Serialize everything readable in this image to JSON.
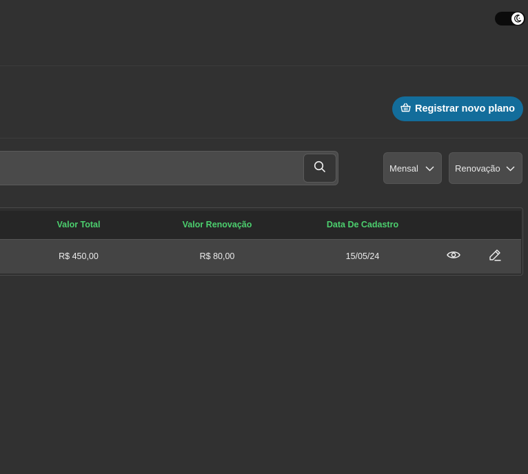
{
  "header": {
    "theme_toggle_icon": "moon-icon"
  },
  "actions": {
    "register_label": "Registrar novo plano",
    "register_icon": "basket-icon"
  },
  "filters": {
    "search_value": "",
    "search_icon": "search-icon",
    "period_select": {
      "selected": "Mensal"
    },
    "type_select": {
      "selected": "Renovação"
    }
  },
  "table": {
    "columns": [
      "Valor Total",
      "Valor Renovação",
      "Data De Cadastro"
    ],
    "rows": [
      {
        "valor_total": "R$ 450,00",
        "valor_renovacao": "R$ 80,00",
        "data_cadastro": "15/05/24",
        "actions": [
          "eye-icon",
          "pencil-icon"
        ]
      }
    ]
  },
  "colors": {
    "background": "#313131",
    "accent_button": "#136d9b",
    "header_text": "#4ccf6e"
  }
}
